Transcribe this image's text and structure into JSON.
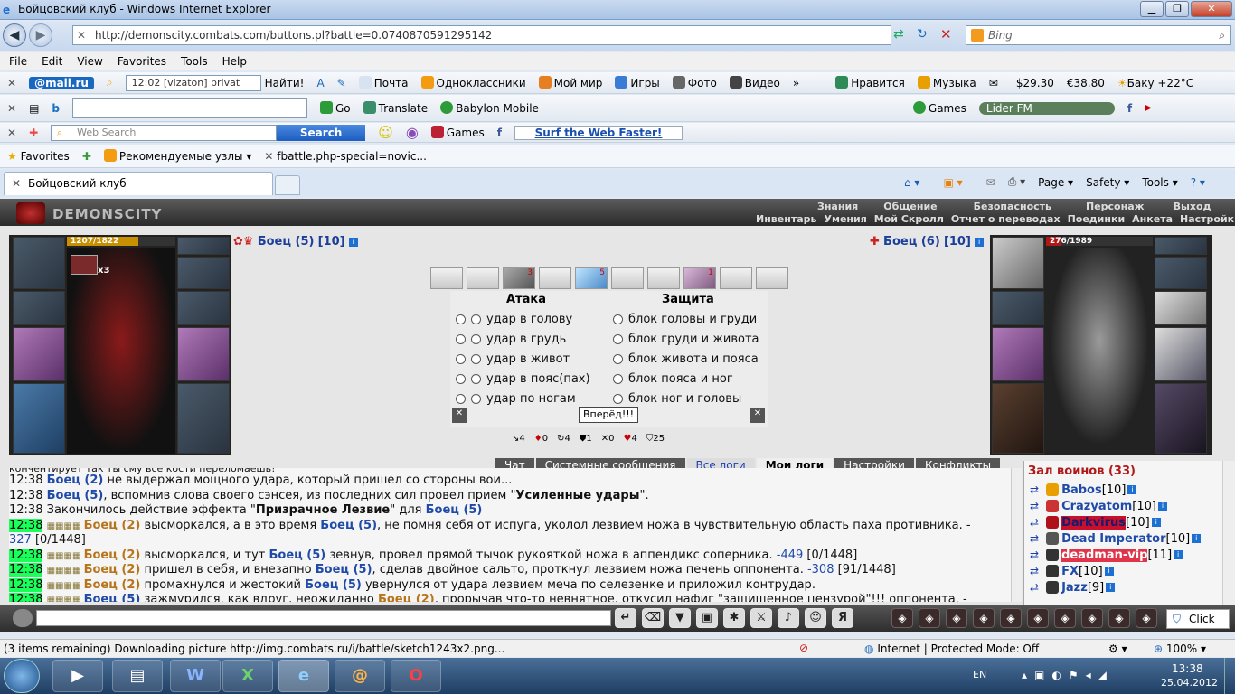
{
  "window": {
    "title": "Бойцовский клуб - Windows Internet Explorer",
    "minimize": "▁",
    "maximize": "❐",
    "close": "✕"
  },
  "address": {
    "url": "http://demonscity.combats.com/buttons.pl?battle=0.0740870591295142",
    "search_placeholder": "Bing"
  },
  "menu": [
    "File",
    "Edit",
    "View",
    "Favorites",
    "Tools",
    "Help"
  ],
  "mailbar": {
    "brand": "@mail.ru",
    "field": "12:02 [vizaton] privat",
    "find": "Найти!",
    "items": [
      "Почта",
      "Одноклассники",
      "Мой мир",
      "Игры",
      "Фото",
      "Видео"
    ],
    "right": [
      "Нравится",
      "Музыка",
      "$29.30",
      "€38.80",
      "Баку +22°C"
    ]
  },
  "babylon": {
    "go": "Go",
    "translate": "Translate",
    "mobile": "Babylon Mobile",
    "games": "Games",
    "radio": "Lider FM"
  },
  "websearch": {
    "placeholder": "Web Search",
    "button": "Search",
    "games": "Games",
    "surf": "Surf the Web Faster!"
  },
  "favorites": {
    "label": "Favorites",
    "items": [
      "Рекомендуемые узлы",
      "fbattle.php-special=novic..."
    ]
  },
  "tab": {
    "title": "Бойцовский клуб"
  },
  "cmdbar": {
    "page": "Page",
    "safety": "Safety",
    "tools": "Tools"
  },
  "game": {
    "logo": "DEMONSCITY",
    "links_top": [
      "Знания",
      "Общение",
      "Безопасность",
      "Персонаж",
      "Выход"
    ],
    "links_bottom": [
      "Инвентарь",
      "Умения",
      "Мой Скролл",
      "Отчет о переводах",
      "Поединки",
      "Анкета",
      "Настройки"
    ],
    "left": {
      "name": "Боец (5)",
      "level": "[10]",
      "hp": "1207/1822",
      "badge": "x3"
    },
    "right": {
      "name": "Боец (6)",
      "level": "[10]",
      "hp": "276/1989"
    },
    "scroll_counts": [
      "3",
      "5",
      "1"
    ],
    "attack_title": "Атака",
    "defense_title": "Защита",
    "attacks": [
      "удар в голову",
      "удар в грудь",
      "удар в живот",
      "удар в пояс(пах)",
      "удар по ногам"
    ],
    "defenses": [
      "блок головы и груди",
      "блок груди и живота",
      "блок живота и пояса",
      "блок пояса и ног",
      "блок ног и головы"
    ],
    "forward": "Вперёд!!!",
    "stats": [
      "4",
      "0",
      "4",
      "1",
      "0",
      "4",
      "25"
    ],
    "log_tabs": [
      "Чат",
      "Системные сообщения",
      "Все логи",
      "Мои логи",
      "Настройки",
      "Конфликты"
    ],
    "users_title": "Зал воинов (33)",
    "users": [
      {
        "name": "Babos",
        "level": "[10]"
      },
      {
        "name": "Crazyatom",
        "level": "[10]"
      },
      {
        "name": "Darkvirus",
        "level": "[10]"
      },
      {
        "name": "Dead Imperator",
        "level": "[10]"
      },
      {
        "name": "deadman-vip",
        "level": "[11]"
      },
      {
        "name": "FX",
        "level": "[10]"
      },
      {
        "name": "Jazz",
        "level": "[9]"
      }
    ],
    "log_partial": "кончентирует так ты сму все кости переломаешь!",
    "log": [
      {
        "t": "12:38",
        "hl": false,
        "parts": [
          [
            "b",
            "Боец (2)"
          ],
          [
            "n",
            " не выдержал мощного удара, который пришел со стороны вои..."
          ]
        ]
      },
      {
        "t": "12:38",
        "hl": false,
        "parts": [
          [
            "b",
            "Боец (5)"
          ],
          [
            "n",
            ", вспомнив слова своего сэнсея, из последних сил провел прием \""
          ],
          [
            "k",
            "Усиленные удары"
          ],
          [
            "n",
            "\"."
          ]
        ]
      },
      {
        "t": "12:38",
        "hl": false,
        "parts": [
          [
            "n",
            "Закончилось действие эффекта \""
          ],
          [
            "k",
            "Призрачное Лезвие"
          ],
          [
            "n",
            "\" для "
          ],
          [
            "b",
            "Боец (5)"
          ]
        ]
      },
      {
        "t": "12:38",
        "hl": true,
        "parts": [
          [
            "o",
            "Боец (2)"
          ],
          [
            "n",
            " высморкался, а в это время "
          ],
          [
            "b",
            "Боец (5)"
          ],
          [
            "n",
            ", не помня себя от испуга, уколол лезвием ножа в чувствительную область паха противника. -"
          ]
        ]
      },
      {
        "t": "",
        "hl": false,
        "parts": [
          [
            "d",
            "327"
          ],
          [
            "n",
            " [0/1448]"
          ]
        ]
      },
      {
        "t": "12:38",
        "hl": true,
        "parts": [
          [
            "o",
            "Боец (2)"
          ],
          [
            "n",
            " высморкался, и тут "
          ],
          [
            "b",
            "Боец (5)"
          ],
          [
            "n",
            " зевнув, провел прямой тычок рукояткой ножа в аппендикс соперника. "
          ],
          [
            "d",
            "-449"
          ],
          [
            "n",
            " [0/1448]"
          ]
        ]
      },
      {
        "t": "12:38",
        "hl": true,
        "parts": [
          [
            "o",
            "Боец (2)"
          ],
          [
            "n",
            " пришел в себя, и внезапно "
          ],
          [
            "b",
            "Боец (5)"
          ],
          [
            "n",
            ", сделав двойное сальто, проткнул лезвием ножа печень оппонента. "
          ],
          [
            "d",
            "-308"
          ],
          [
            "n",
            " [91/1448]"
          ]
        ]
      },
      {
        "t": "12:38",
        "hl": true,
        "parts": [
          [
            "o",
            "Боец (2)"
          ],
          [
            "n",
            " промахнулся и жестокий "
          ],
          [
            "b",
            "Боец (5)"
          ],
          [
            "n",
            " увернулся от удара лезвием меча по селезенке и приложил контрудар."
          ]
        ]
      },
      {
        "t": "12:38",
        "hl": true,
        "parts": [
          [
            "b",
            "Боец (5)"
          ],
          [
            "n",
            " зажмурился, как вдруг, неожиданно "
          ],
          [
            "o",
            "Боец (2)"
          ],
          [
            "n",
            ", прорычав что-то невнятное, откусил нафиг \"защищенное цензурой\"!!! оппонента. -"
          ]
        ]
      }
    ],
    "click": "Click"
  },
  "status": {
    "text": "(3 items remaining) Downloading picture http://img.combats.ru/i/battle/sketch1243x2.png...",
    "zone": "Internet | Protected Mode: Off",
    "zoom": "100%"
  },
  "taskbar": {
    "lang": "EN",
    "time": "13:38",
    "date": "25.04.2012"
  }
}
